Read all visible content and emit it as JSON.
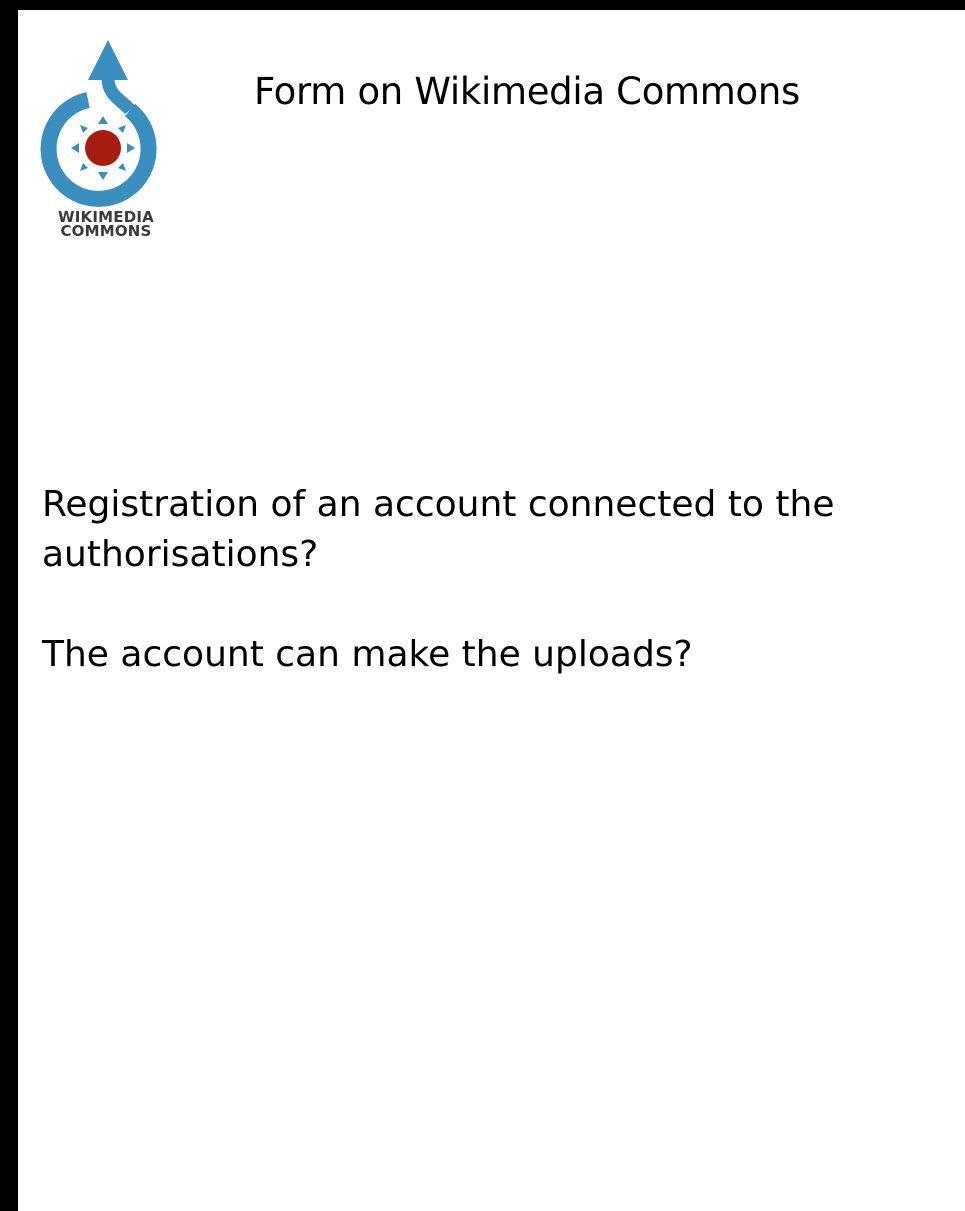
{
  "slide": {
    "title": "Form on Wikimedia Commons",
    "logo": {
      "icon": "wikimedia-commons-logo",
      "line1": "WIKIMEDIA",
      "line2": "COMMONS",
      "colors": {
        "blue": "#3b8ec0",
        "red": "#a81c12"
      }
    },
    "paragraphs": [
      "Registration of an account connected to the authorisations?",
      "The account can make the uploads?"
    ]
  }
}
